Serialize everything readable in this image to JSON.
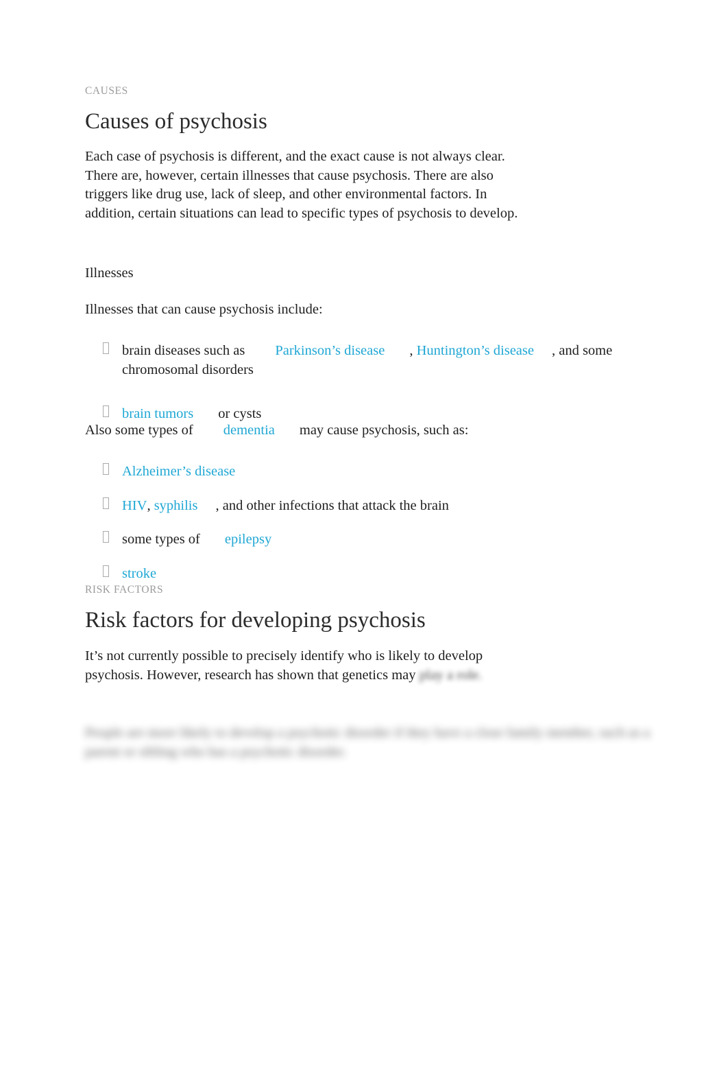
{
  "document": {
    "background_color": "#ffffff",
    "link_color": "#1fa7d4",
    "eyebrow_color": "#9a9a9a",
    "heading_color": "#2b2b2b",
    "body_color": "#1e1e1e"
  },
  "causes_section": {
    "eyebrow": "CAUSES",
    "heading": "Causes of psychosis",
    "intro": "Each case of psychosis is different, and the exact cause is not always clear. There are, however, certain illnesses that cause psychosis. There are also triggers like drug use, lack of sleep, and other environmental factors. In addition, certain situations can lead to specific types of psychosis to develop.",
    "subhead": "Illnesses",
    "list_lead": "Illnesses that can cause psychosis include:",
    "illness_list": [
      {
        "pre": "brain diseases such as",
        "link1": "Parkinson’s disease",
        "mid": ",",
        "link2": "Huntington’s disease",
        "post": ", and some chromosomal disorders"
      },
      {
        "link1": "brain tumors",
        "post": "or cysts"
      }
    ],
    "dementia_lead": {
      "pre": "Also some types of",
      "link": "dementia",
      "post": "may cause psychosis, such as:"
    },
    "dementia_list": [
      {
        "link1": "Alzheimer’s disease",
        "post": ""
      },
      {
        "link1": "HIV",
        "sep": ",",
        "link2": "syphilis",
        "post": ", and other infections that attack the brain"
      },
      {
        "pre": "some types of",
        "link1": "epilepsy",
        "post": ""
      },
      {
        "link1": "stroke",
        "post": ""
      }
    ]
  },
  "risk_factors_section": {
    "eyebrow": "RISK FACTORS",
    "heading": "Risk factors for developing psychosis",
    "intro_line1": "It’s not currently possible to precisely identify who is likely to",
    "intro_line2": "develop psychosis. However, research has shown that genetics may",
    "intro_line3_blurred": "play a role.",
    "blurred_paragraph": "People are more likely to develop a psychotic disorder if they have a close family member, such as a parent or sibling who has a psychotic disorder."
  }
}
